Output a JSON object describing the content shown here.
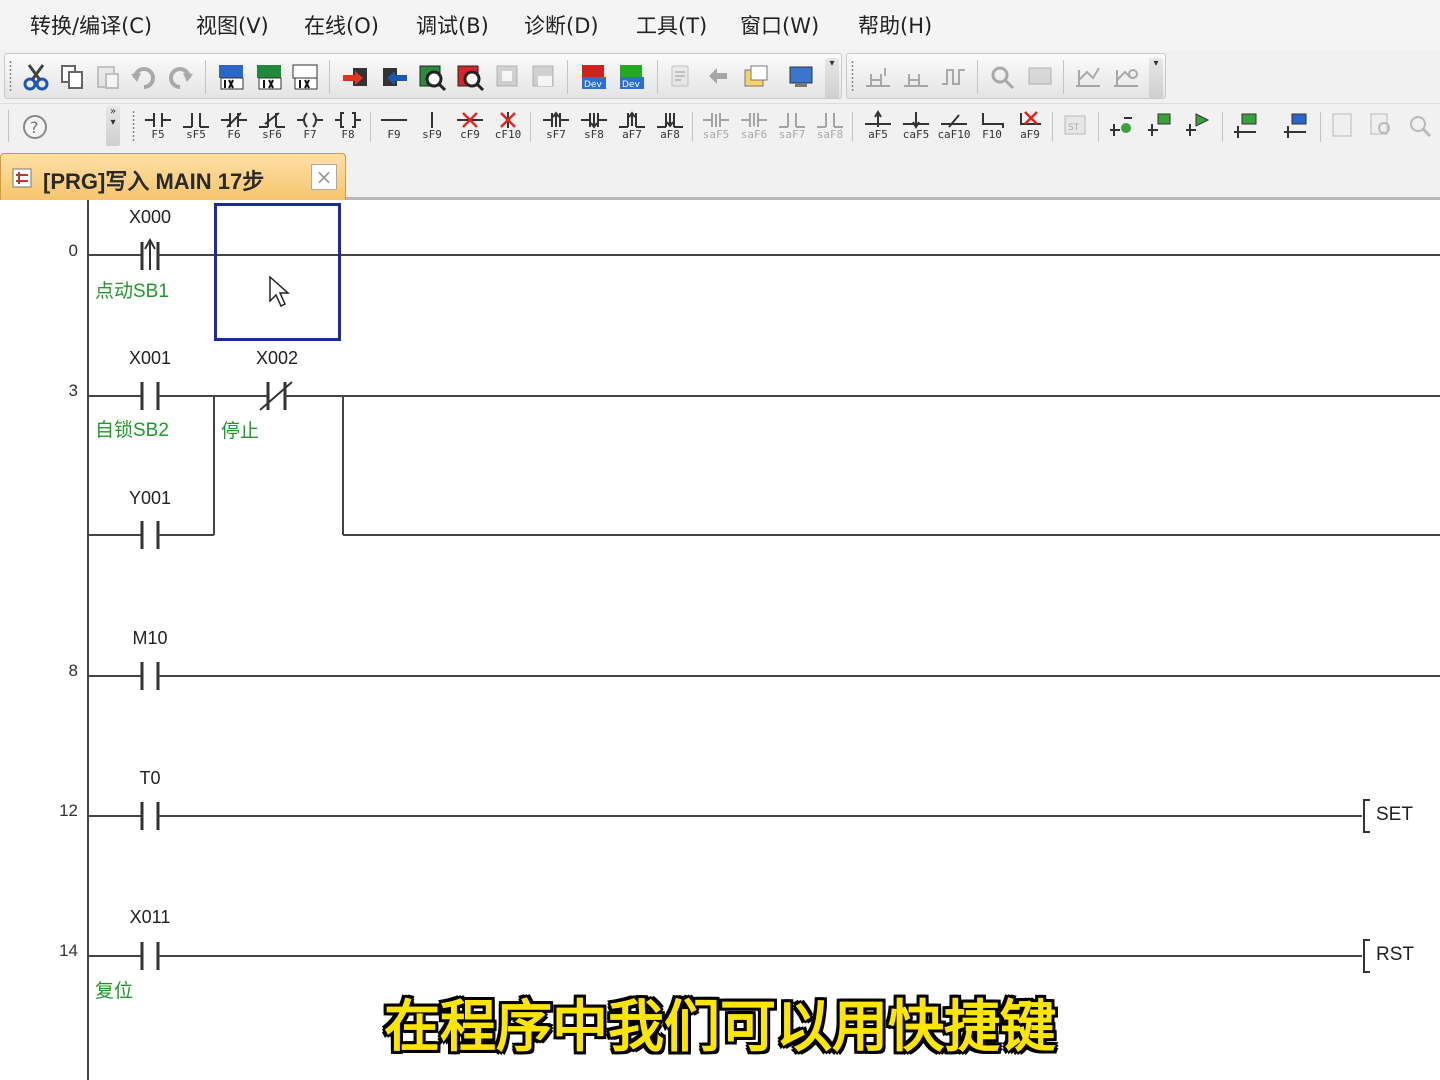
{
  "menu": {
    "items": [
      {
        "label": "转换/编译(C)"
      },
      {
        "label": "视图(V)"
      },
      {
        "label": "在线(O)"
      },
      {
        "label": "调试(B)"
      },
      {
        "label": "诊断(D)"
      },
      {
        "label": "工具(T)"
      },
      {
        "label": "窗口(W)"
      },
      {
        "label": "帮助(H)"
      }
    ]
  },
  "ladder_toolbar": {
    "keys": [
      "F5",
      "sF5",
      "F6",
      "sF6",
      "F7",
      "F8",
      "F9",
      "sF9",
      "cF9",
      "cF10",
      "sF7",
      "sF8",
      "aF7",
      "aF8",
      "saF5",
      "saF6",
      "saF7",
      "saF8",
      "aF5",
      "caF5",
      "caF10",
      "F10",
      "aF9"
    ]
  },
  "tab": {
    "title": "[PRG]写入 MAIN 17步",
    "close_label": "×"
  },
  "rungs": [
    {
      "step": "0",
      "contacts": [
        {
          "device": "X000",
          "type": "rising-edge",
          "comment": "点动SB1"
        }
      ]
    },
    {
      "step": "3",
      "contacts": [
        {
          "device": "X001",
          "type": "NO",
          "comment": "自锁SB2"
        },
        {
          "device": "X002",
          "type": "NC",
          "comment": "停止"
        },
        {
          "device": "Y001",
          "type": "NO",
          "comment": ""
        }
      ]
    },
    {
      "step": "8",
      "contacts": [
        {
          "device": "M10",
          "type": "NO",
          "comment": ""
        }
      ]
    },
    {
      "step": "12",
      "contacts": [
        {
          "device": "T0",
          "type": "NO",
          "comment": ""
        }
      ],
      "instruction": "SET"
    },
    {
      "step": "14",
      "contacts": [
        {
          "device": "X011",
          "type": "NO",
          "comment": "复位"
        }
      ],
      "instruction": "RST"
    }
  ],
  "subtitle": "在程序中我们可以用快捷键",
  "colors": {
    "comment": "#1f9a2a",
    "cursor": "#1a2c9c",
    "subtitle": "#ffe600",
    "tab": "#f6c56c"
  }
}
